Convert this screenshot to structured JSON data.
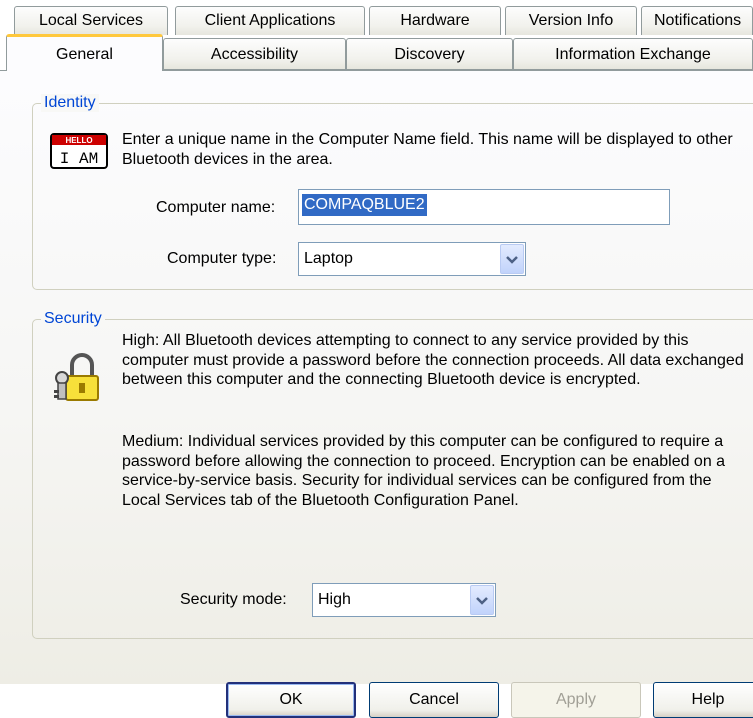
{
  "tabs": {
    "row1": [
      {
        "label": "Local Services"
      },
      {
        "label": "Client Applications"
      },
      {
        "label": "Hardware"
      },
      {
        "label": "Version Info"
      },
      {
        "label": "Notifications"
      }
    ],
    "row2": [
      {
        "label": "General"
      },
      {
        "label": "Accessibility"
      },
      {
        "label": "Discovery"
      },
      {
        "label": "Information Exchange"
      }
    ]
  },
  "identity": {
    "legend": "Identity",
    "badge_top": "HELLO",
    "badge_main": "I AM",
    "description": "Enter a unique name in the Computer Name field. This name will be displayed to other Bluetooth devices in the area.",
    "computer_name_label": "Computer name:",
    "computer_name_value": "COMPAQBLUE2",
    "computer_type_label": "Computer type:",
    "computer_type_value": "Laptop"
  },
  "security": {
    "legend": "Security",
    "high_text": "High: All Bluetooth devices attempting to connect to any service provided by this computer must provide a password before the connection proceeds. All data exchanged between this computer and the connecting Bluetooth device is encrypted.",
    "medium_text": "Medium: Individual services provided by this computer can be configured to require a password before allowing the connection to proceed. Encryption can be enabled on a service-by-service basis. Security for individual services can be configured from the Local Services tab of the Bluetooth Configuration Panel.",
    "mode_label": "Security mode:",
    "mode_value": "High"
  },
  "buttons": {
    "ok": "OK",
    "cancel": "Cancel",
    "apply": "Apply",
    "help": "Help"
  },
  "colors": {
    "legend": "#0046d5",
    "active_tab_accent": "#ffc83c",
    "selection": "#316ac5"
  },
  "icons": {
    "identity": "hello-i-am-badge-icon",
    "security": "padlock-keys-icon",
    "dropdown": "chevron-down-icon"
  }
}
